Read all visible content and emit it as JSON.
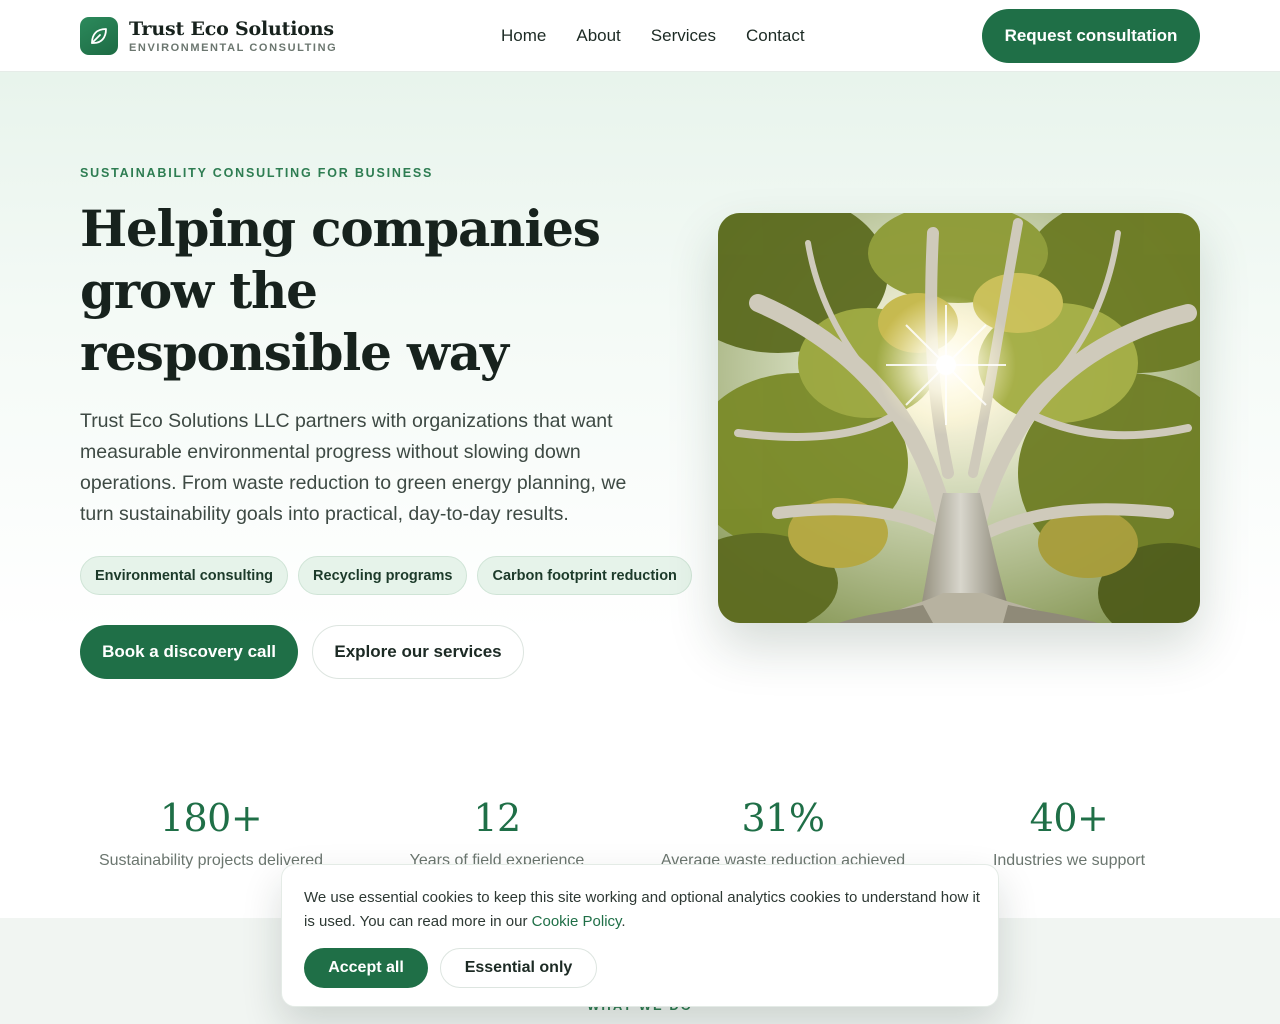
{
  "brand": {
    "name": "Trust Eco Solutions",
    "tagline": "ENVIRONMENTAL CONSULTING",
    "logo_icon": "leaf-icon",
    "color": "#1f6f47"
  },
  "nav": {
    "items": [
      {
        "label": "Home"
      },
      {
        "label": "About"
      },
      {
        "label": "Services"
      },
      {
        "label": "Contact"
      }
    ],
    "cta_label": "Request consultation"
  },
  "hero": {
    "eyebrow": "SUSTAINABILITY CONSULTING FOR BUSINESS",
    "title": "Helping companies grow the responsible way",
    "description": "Trust Eco Solutions LLC partners with organizations that want measurable environmental progress without slowing down operations. From waste reduction to green energy planning, we turn sustainability goals into practical, day-to-day results.",
    "chips": [
      {
        "label": "Environmental consulting"
      },
      {
        "label": "Recycling programs"
      },
      {
        "label": "Carbon footprint reduction"
      }
    ],
    "primary_button": "Book a discovery call",
    "secondary_button": "Explore our services",
    "image_icon": "tree-photo"
  },
  "stats": [
    {
      "value": "180+",
      "label": "Sustainability projects delivered"
    },
    {
      "value": "12",
      "label": "Years of field experience"
    },
    {
      "value": "31%",
      "label": "Average waste reduction achieved"
    },
    {
      "value": "40+",
      "label": "Industries we support"
    }
  ],
  "section": {
    "eyebrow": "WHAT WE DO"
  },
  "cookie": {
    "text": "We use essential cookies to keep this site working and optional analytics cookies to understand how it is used. You can read more in our ",
    "link_label": "Cookie Policy",
    "text_end": ".",
    "accept_label": "Accept all",
    "essential_label": "Essential only"
  },
  "colors": {
    "primary": "#1f6f47",
    "accent_text": "#2e7d52",
    "chip_bg": "#e6f3ea"
  }
}
